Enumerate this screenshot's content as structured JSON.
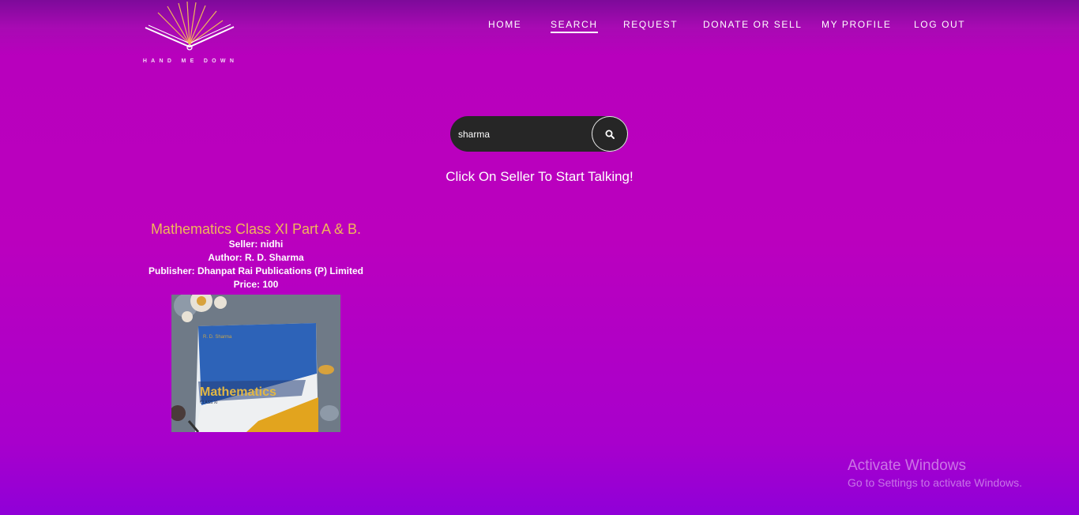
{
  "logo": {
    "text": "HAND ME DOWN",
    "icon": "open-book-rays-icon"
  },
  "nav": {
    "home": "HOME",
    "search": "SEARCH",
    "request": "REQUEST",
    "donate": "DONATE OR SELL",
    "profile": "MY PROFILE",
    "logout": "LOG OUT",
    "active": "SEARCH"
  },
  "search": {
    "value": "sharma",
    "button_icon": "search-icon"
  },
  "hint": "Click On Seller To Start Talking!",
  "results": [
    {
      "title": "Mathematics Class XI Part A & B.",
      "seller": "Seller: nidhi",
      "author": "Author: R. D. Sharma",
      "publisher": "Publisher: Dhanpat Rai Publications (P) Limited",
      "price": "Price: 100",
      "image": {
        "cover_author": "R. D. Sharma",
        "cover_title": "Mathematics",
        "cover_subtitle": "CLASS XI"
      }
    }
  ],
  "watermark": {
    "line1": "Activate Windows",
    "line2": "Go to Settings to activate Windows."
  },
  "colors": {
    "title": "#f0b65a",
    "search_bg": "#262626",
    "background_top": "#7d0a9a",
    "background_main": "#bb00be"
  }
}
